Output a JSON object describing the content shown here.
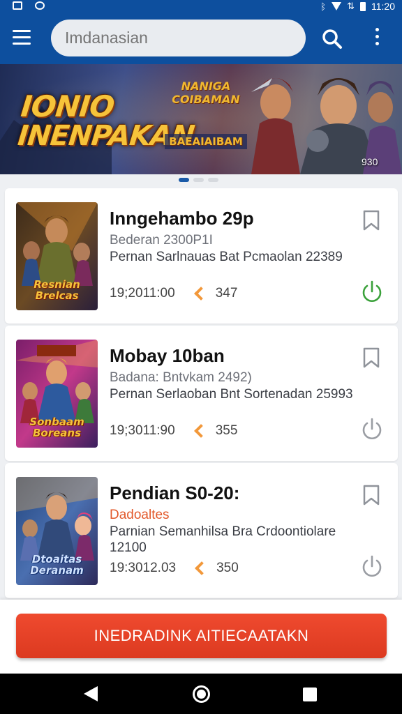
{
  "status_bar": {
    "time": "11:20",
    "icons": [
      "image-icon",
      "sync-icon",
      "bluetooth-icon",
      "wifi-icon",
      "signal-icon",
      "data-icon",
      "battery-icon"
    ]
  },
  "toolbar": {
    "menu_icon": "menu-icon",
    "search_placeholder": "Imdanasian",
    "search_icon": "search-icon",
    "more_icon": "more-vert-icon",
    "background_color": "#0d4f9e"
  },
  "banner": {
    "title_line1": "IONIO",
    "title_line2": "INENPAKAN",
    "subtitle_top": "NANIGA COIBAMAN",
    "subtitle_bottom": "BAEAIAIBAM",
    "year": "930",
    "slide_count": 3,
    "active_slide": 0
  },
  "games": [
    {
      "title": "Inngehambo 29p",
      "subtitle": "Bederan 2300P1I",
      "description": "Pernan Sarlnauas Bat Pcmaolan 22389",
      "time": "19;2011:00",
      "likes": "347",
      "thumb_label": "Resnian Brelcas",
      "power_color": "#3aa13a"
    },
    {
      "title": "Mobay 10ban",
      "subtitle": "Badana: Bntvkam  2492)",
      "description": "Pernan Serlaoban Bnt Sortenadan 25993",
      "time": "19;3011:90",
      "likes": "355",
      "thumb_label": "Sonbaam Boreans",
      "power_color": "#9a9da3"
    },
    {
      "title": "Pendian S0-20:",
      "subtitle": "Dadoaltes",
      "description": "Parnian Semanhilsa Bra Crdoontiolare 12100",
      "time": "19:3012.03",
      "likes": "350",
      "thumb_label": "Dtoaitas Deranam",
      "power_color": "#9a9da3"
    }
  ],
  "cta": {
    "label": "INEDRADINK AITIECAATAKN",
    "color": "#e3432a"
  },
  "nav": {
    "back_icon": "back-icon",
    "home_icon": "home-icon",
    "recents_icon": "recents-icon"
  }
}
